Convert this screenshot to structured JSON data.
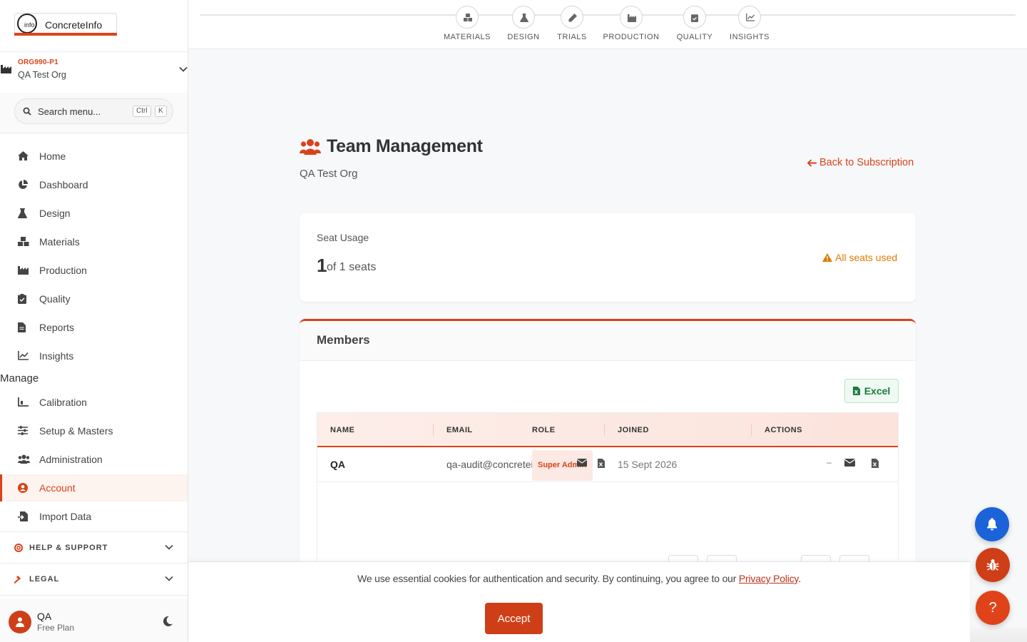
{
  "brand": {
    "name": "ConcreteInfo",
    "mark": "info",
    "accent": "#d9421a"
  },
  "org": {
    "code": "ORG990-P1",
    "name": "QA Test Org"
  },
  "search": {
    "placeholder": "Search menu...",
    "kbd_ctrl": "Ctrl",
    "kbd_k": "K"
  },
  "nav": {
    "main": [
      {
        "label": "Home",
        "icon": "home-icon"
      },
      {
        "label": "Dashboard",
        "icon": "pie-chart-icon"
      },
      {
        "label": "Design",
        "icon": "flask-icon"
      },
      {
        "label": "Materials",
        "icon": "cubes-icon"
      },
      {
        "label": "Production",
        "icon": "factory-icon"
      },
      {
        "label": "Quality",
        "icon": "clipboard-check-icon"
      },
      {
        "label": "Reports",
        "icon": "file-icon"
      },
      {
        "label": "Insights",
        "icon": "line-chart-icon"
      }
    ],
    "manage_label": "Manage",
    "manage": [
      {
        "label": "Calibration",
        "icon": "calibration-icon"
      },
      {
        "label": "Setup & Masters",
        "icon": "sliders-icon"
      },
      {
        "label": "Administration",
        "icon": "users-icon"
      },
      {
        "label": "Account",
        "icon": "user-circle-icon",
        "active": true
      },
      {
        "label": "Import Data",
        "icon": "file-import-icon"
      }
    ],
    "help": "HELP & SUPPORT",
    "legal": "LEGAL"
  },
  "user": {
    "name": "QA",
    "plan": "Free Plan"
  },
  "stepper": [
    "MATERIALS",
    "DESIGN",
    "TRIALS",
    "PRODUCTION",
    "QUALITY",
    "INSIGHTS"
  ],
  "page": {
    "title": "Team Management",
    "subtitle": "QA Test Org",
    "back": "Back to Subscription"
  },
  "seats": {
    "title": "Seat Usage",
    "used": "1",
    "of_text": "of 1 seats",
    "warning": "All seats used",
    "warning_color": "#e07b00"
  },
  "members": {
    "title": "Members",
    "excel": "Excel",
    "columns": [
      "NAME",
      "EMAIL",
      "ROLE",
      "JOINED",
      "ACTIONS"
    ],
    "rows": [
      {
        "name": "QA",
        "email": "qa-audit@concreteinfo.co.in",
        "role": "Super Admin",
        "joined": "15 Sept 2026",
        "actions_dash": "–"
      }
    ]
  },
  "cookie": {
    "text": "We use essential cookies for authentication and security. By continuing, you agree to our ",
    "link": "Privacy Policy",
    "period": ".",
    "accept": "Accept"
  },
  "fabs": {
    "help": "?"
  }
}
